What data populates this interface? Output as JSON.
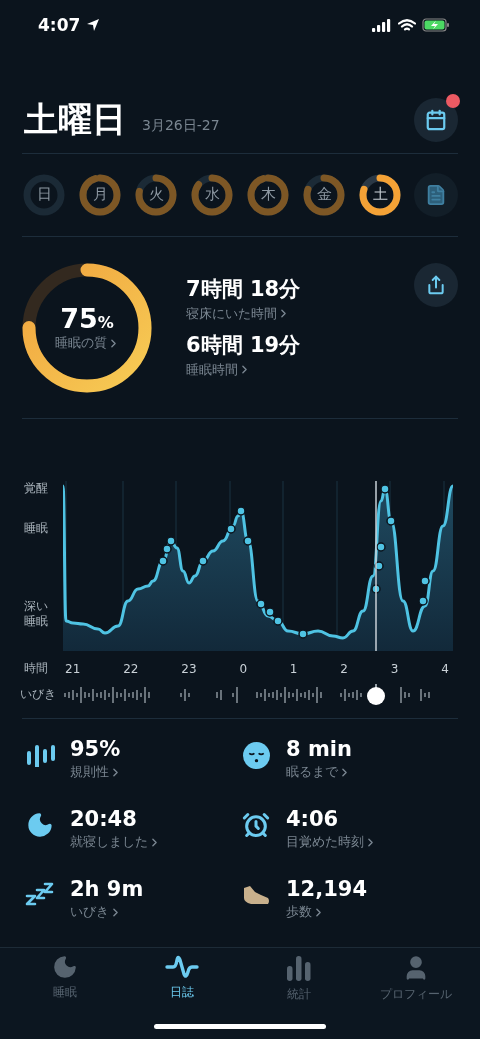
{
  "status_bar": {
    "time": "4:07"
  },
  "header": {
    "title": "土曜日",
    "date_range": "3月26日-27",
    "calendar_badge": true
  },
  "days": [
    {
      "label": "日",
      "selected": false
    },
    {
      "label": "月",
      "selected": false
    },
    {
      "label": "火",
      "selected": false
    },
    {
      "label": "水",
      "selected": false
    },
    {
      "label": "木",
      "selected": false
    },
    {
      "label": "金",
      "selected": false
    },
    {
      "label": "土",
      "selected": true
    }
  ],
  "summary": {
    "quality": {
      "value": "75",
      "unit": "%",
      "label": "睡眠の質",
      "level": 0.75
    },
    "metrics": [
      {
        "value": "7時間 18分",
        "label": "寝床にいた時間"
      },
      {
        "value": "6時間 19分",
        "label": "睡眠時間"
      }
    ]
  },
  "sleep_graph": {
    "y_labels": [
      "覚醒",
      "睡眠",
      "深い睡眠"
    ],
    "x_label": "時間",
    "x_ticks": [
      "21",
      "22",
      "23",
      "0",
      "1",
      "2",
      "3",
      "4"
    ],
    "snore_label": "いびき"
  },
  "stats": [
    {
      "kind": "regularity",
      "value": "95%",
      "label": "規則性"
    },
    {
      "kind": "latency",
      "value": "8 min",
      "label": "眠るまで"
    },
    {
      "kind": "bedtime",
      "value": "20:48",
      "label": "就寝しました"
    },
    {
      "kind": "wake",
      "value": "4:06",
      "label": "目覚めた時刻"
    },
    {
      "kind": "snore",
      "value": "2h 9m",
      "label": "いびき"
    },
    {
      "kind": "steps",
      "value": "12,194",
      "label": "歩数"
    }
  ],
  "tab_bar": [
    {
      "kind": "sleep",
      "label": "睡眠",
      "selected": false
    },
    {
      "kind": "journal",
      "label": "日誌",
      "selected": true
    },
    {
      "kind": "stats",
      "label": "統計",
      "selected": false
    },
    {
      "kind": "profile",
      "label": "プロフィール",
      "selected": false
    }
  ]
}
